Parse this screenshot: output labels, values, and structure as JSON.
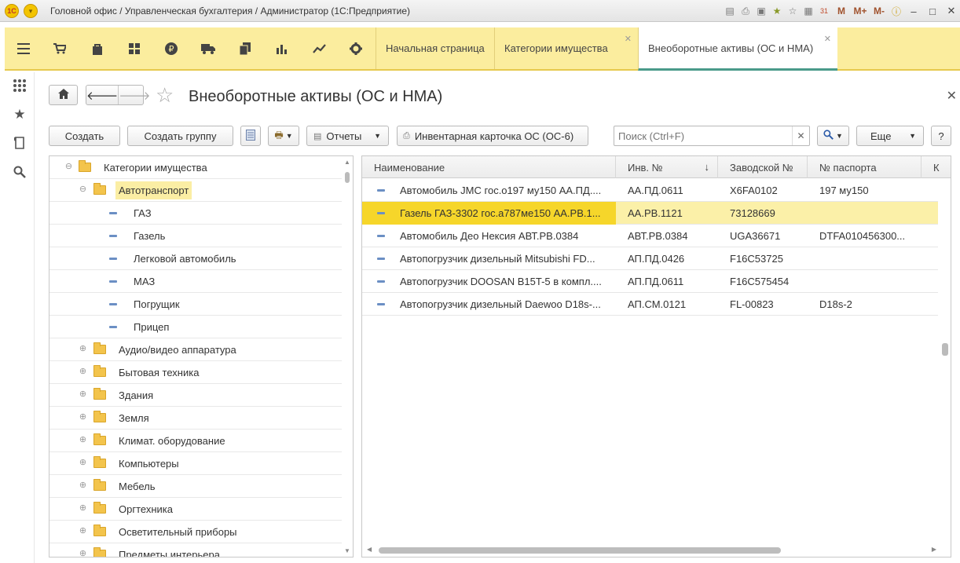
{
  "titlebar": {
    "logo": "1С",
    "title": "Головной офис / Управленческая бухгалтерия / Администратор  (1С:Предприятие)",
    "m_labels": [
      "M",
      "M+",
      "M-"
    ],
    "calendar_day": "31"
  },
  "sections": {
    "icons": [
      "menu-icon",
      "cart-icon",
      "bag-icon",
      "grid-icon",
      "ruble-icon",
      "truck-icon",
      "documents-icon",
      "chart-bar-icon",
      "trend-icon",
      "gear-icon"
    ]
  },
  "tabs": [
    {
      "label": "Начальная страница",
      "active": false
    },
    {
      "label": "Категории имущества",
      "active": false
    },
    {
      "label": "Внеоборотные активы (ОС и НМА)",
      "active": true
    }
  ],
  "form": {
    "title": "Внеоборотные активы (ОС и НМА)"
  },
  "toolbar": {
    "create": "Создать",
    "create_group": "Создать группу",
    "reports": "Отчеты",
    "inventory_card": "Инвентарная карточка ОС (ОС-6)",
    "search_placeholder": "Поиск (Ctrl+F)",
    "more": "Еще",
    "help": "?"
  },
  "tree": {
    "root": "Категории имущества",
    "expanded_group": "Автотранспорт",
    "children": [
      "ГАЗ",
      "Газель",
      "Легковой автомобиль",
      "МАЗ",
      "Погрущик",
      "Прицеп"
    ],
    "groups": [
      "Аудио/видео аппаратура",
      "Бытовая техника",
      "Здания",
      "Земля",
      "Климат. оборудование",
      "Компьютеры",
      "Мебель",
      "Оргтехника",
      "Осветительный приборы",
      "Предметы интерьера"
    ]
  },
  "table": {
    "columns": [
      "Наименование",
      "Инв. №",
      "Заводской №",
      "№ паспорта",
      "К"
    ],
    "sort_indicator": "↓",
    "rows": [
      {
        "name": "Автомобиль JMC гос.о197 му150 АА.ПД....",
        "inv": "АА.ПД.0611",
        "serial": "X6FA0102",
        "passport": "197 му150",
        "selected": false
      },
      {
        "name": "Газель ГАЗ-3302 гос.а787ме150 АА.РВ.1...",
        "inv": "АА.РВ.1121",
        "serial": "73128669",
        "passport": "",
        "selected": true
      },
      {
        "name": "Автомобиль Део Нексия АВТ.РВ.0384",
        "inv": "АВТ.РВ.0384",
        "serial": "UGA36671",
        "passport": "DTFA010456300...",
        "selected": false
      },
      {
        "name": "Автопогрузчик дизельный Mitsubishi FD...",
        "inv": "АП.ПД.0426",
        "serial": "F16C53725",
        "passport": "",
        "selected": false
      },
      {
        "name": "Автопогрузчик DOOSAN B15T-5 в компл....",
        "inv": "АП.ПД.0611",
        "serial": "F16C575454",
        "passport": "",
        "selected": false
      },
      {
        "name": "Автопогрузчик дизельный Daewoo D18s-...",
        "inv": "АП.СМ.0121",
        "serial": "FL-00823",
        "passport": "D18s-2",
        "selected": false
      }
    ]
  }
}
